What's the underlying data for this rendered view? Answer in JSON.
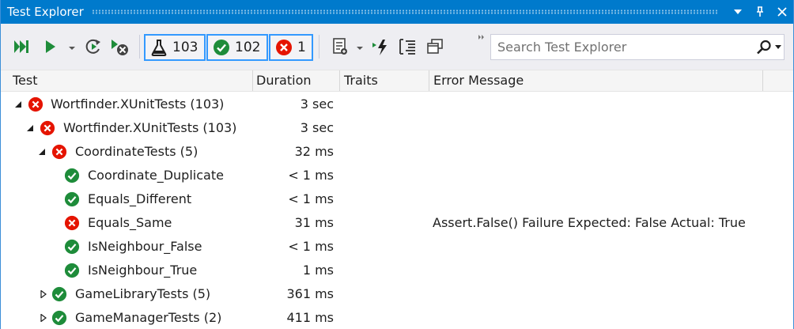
{
  "window": {
    "title": "Test Explorer"
  },
  "toolbar": {
    "counters": {
      "total": "103",
      "passed": "102",
      "failed": "1"
    },
    "search": {
      "placeholder": "Search Test Explorer"
    }
  },
  "columns": {
    "test": "Test",
    "duration": "Duration",
    "traits": "Traits",
    "error": "Error Message"
  },
  "rows": [
    {
      "name": "Wortfinder.XUnitTests  (103)",
      "duration": "3 sec",
      "status": "failed",
      "expander": "open",
      "error": ""
    },
    {
      "name": "Wortfinder.XUnitTests  (103)",
      "duration": "3 sec",
      "status": "failed",
      "expander": "open",
      "error": ""
    },
    {
      "name": "CoordinateTests  (5)",
      "duration": "32 ms",
      "status": "failed",
      "expander": "open",
      "error": ""
    },
    {
      "name": "Coordinate_Duplicate",
      "duration": "< 1 ms",
      "status": "passed",
      "expander": "none",
      "error": ""
    },
    {
      "name": "Equals_Different",
      "duration": "< 1 ms",
      "status": "passed",
      "expander": "none",
      "error": ""
    },
    {
      "name": "Equals_Same",
      "duration": "31 ms",
      "status": "failed",
      "expander": "none",
      "error": "Assert.False() Failure Expected: False Actual:   True"
    },
    {
      "name": "IsNeighbour_False",
      "duration": "< 1 ms",
      "status": "passed",
      "expander": "none",
      "error": ""
    },
    {
      "name": "IsNeighbour_True",
      "duration": "1 ms",
      "status": "passed",
      "expander": "none",
      "error": ""
    },
    {
      "name": "GameLibraryTests  (5)",
      "duration": "361 ms",
      "status": "passed",
      "expander": "closed",
      "error": ""
    },
    {
      "name": "GameManagerTests  (2)",
      "duration": "411 ms",
      "status": "passed",
      "expander": "closed",
      "error": ""
    }
  ],
  "colors": {
    "title_bar": "#007acc",
    "toolbar_bg": "#eeeef2",
    "pass_green": "#1e8c3a",
    "fail_red": "#e51400",
    "counter_border": "#3399ff"
  },
  "icons": {
    "run_all": "run-all-icon",
    "run": "run-icon",
    "repeat_last": "repeat-last-run-icon",
    "cancel": "cancel-run-icon",
    "flask": "flask-icon",
    "passed": "check-circle-icon",
    "failed": "x-circle-icon",
    "playlist": "playlist-icon",
    "live_unit_testing": "lightning-icon",
    "group_by": "group-by-icon",
    "settings": "open-window-icon",
    "search": "search-icon"
  }
}
